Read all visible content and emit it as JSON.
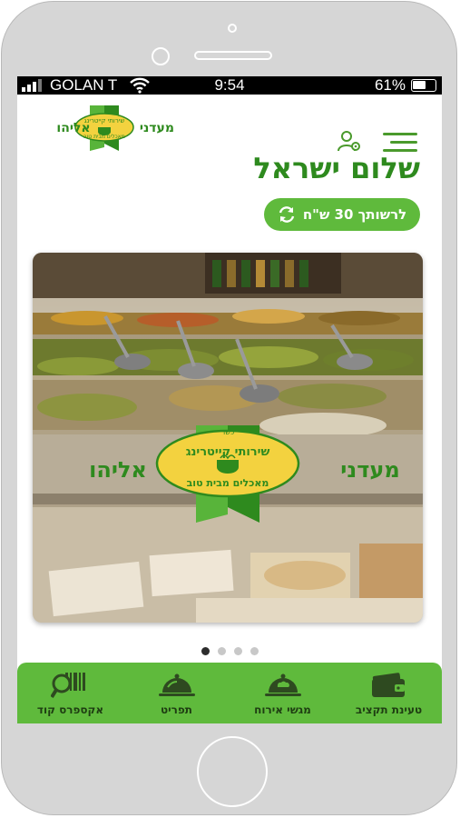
{
  "status_bar": {
    "carrier": "GOLAN T",
    "time": "9:54",
    "battery_percent": "61%",
    "battery_level": 0.61
  },
  "brand": {
    "name_right": "מעדני",
    "name_left": "אליהו",
    "badge_top": "שירותי קייטרינג",
    "badge_bottom": "מאכלים מבית טוב",
    "badge_small": "כשר",
    "colors": {
      "primary": "#5fba3c",
      "dark_green": "#2e8a1e",
      "gold": "#f3d23f"
    }
  },
  "header": {
    "user_icon": "user-settings-icon",
    "menu_icon": "hamburger-menu-icon"
  },
  "greeting": "שלום ישראל",
  "balance_button": {
    "label": "לרשותך 30 ש\"ח",
    "icon": "refresh-icon"
  },
  "carousel": {
    "slide_count": 4,
    "active_index": 0
  },
  "bottom_nav": [
    {
      "label": "אקספרס קוד",
      "icon": "scanner-code-icon"
    },
    {
      "label": "תפריט",
      "icon": "cloche-icon"
    },
    {
      "label": "מגשי אירוח",
      "icon": "chef-cloche-icon"
    },
    {
      "label": "טעינת תקציב",
      "icon": "wallet-icon"
    }
  ]
}
